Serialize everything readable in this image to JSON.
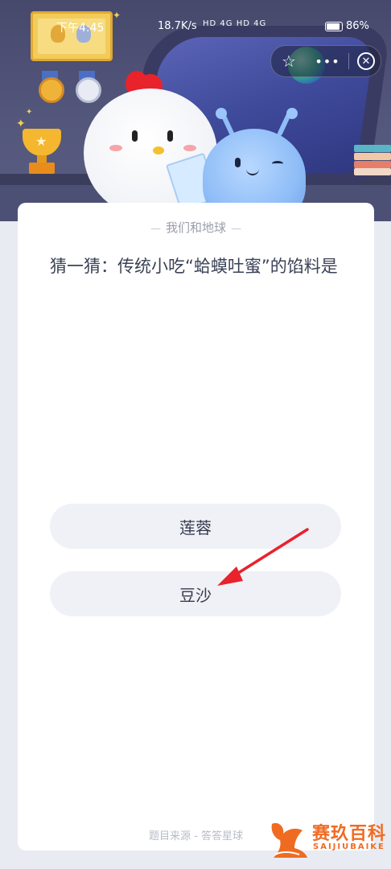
{
  "status_bar": {
    "time": "下午4:45",
    "net_speed": "18.7K/s",
    "signal_labels": "HD 4G HD 4G",
    "battery": "86%"
  },
  "top_controls": {
    "favorite_icon": "star-outline-icon",
    "more_icon": "ellipsis-icon",
    "close_icon": "close-circle-icon"
  },
  "card": {
    "heading": "我们和地球",
    "question": "猜一猜：传统小吃“蛤蟆吐蜜”的馅料是",
    "options": [
      {
        "label": "莲蓉"
      },
      {
        "label": "豆沙"
      }
    ],
    "source": "题目来源 - 答答星球"
  },
  "watermark": {
    "brand_cn": "赛玖百科",
    "brand_en": "SAIJIUBAIKE"
  },
  "colors": {
    "scene_bg": "#4b4e72",
    "card_bg": "#ffffff",
    "option_bg": "#eff1f6",
    "arrow": "#e8232b",
    "watermark": "#f06b22"
  }
}
